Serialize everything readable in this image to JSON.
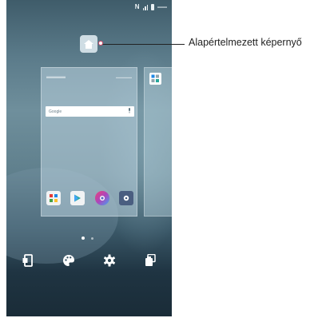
{
  "callout": {
    "label": "Alapértelmezett képernyő"
  },
  "search": {
    "label": "Google"
  },
  "preview": {
    "apps": [
      {
        "icon": "apps-folder-icon",
        "label": ""
      },
      {
        "icon": "play-store-icon",
        "label": ""
      },
      {
        "icon": "camera-icon",
        "label": ""
      },
      {
        "icon": "settings-icon",
        "label": ""
      }
    ]
  },
  "pager": {
    "current_page": 1,
    "total_pages": 2
  },
  "actions": [
    {
      "icon": "widgets-icon",
      "label": ""
    },
    {
      "icon": "themes-palette-icon",
      "label": ""
    },
    {
      "icon": "gear-icon",
      "label": ""
    },
    {
      "icon": "app-trash-icon",
      "label": ""
    }
  ],
  "colors": {
    "callout_dot_border": "#d54b6b",
    "callout_text": "#222222"
  }
}
